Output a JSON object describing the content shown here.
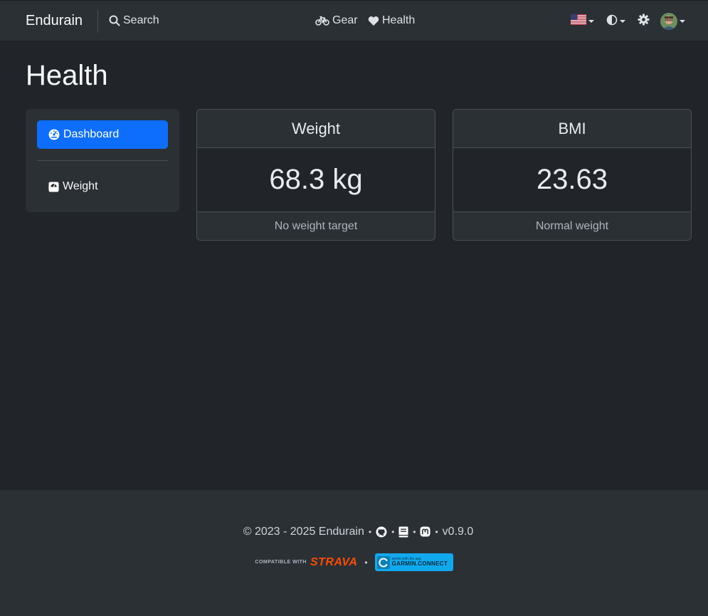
{
  "navbar": {
    "brand": "Endurain",
    "search_label": "Search",
    "gear_label": "Gear",
    "health_label": "Health"
  },
  "page": {
    "title": "Health"
  },
  "sidebar": {
    "items": [
      {
        "label": "Dashboard",
        "icon": "dashboard-gauge-icon",
        "active": true
      },
      {
        "label": "Weight",
        "icon": "weight-scale-icon",
        "active": false
      }
    ]
  },
  "cards": {
    "weight": {
      "title": "Weight",
      "value": "68.3 kg",
      "footer": "No weight target"
    },
    "bmi": {
      "title": "BMI",
      "value": "23.63",
      "footer": "Normal weight"
    }
  },
  "footer": {
    "copyright": "© 2023 - 2025 Endurain",
    "version": "v0.9.0",
    "strava_small": "COMPATIBLE WITH",
    "strava_word": "STRAVA",
    "garmin_small": "works with the app",
    "garmin_word": "GARMIN.CONNECT"
  },
  "colors": {
    "background": "#212529",
    "navbar": "#2b3035",
    "accent": "#0d6efd",
    "strava": "#fc4c02",
    "garmin": "#11a9ed"
  }
}
